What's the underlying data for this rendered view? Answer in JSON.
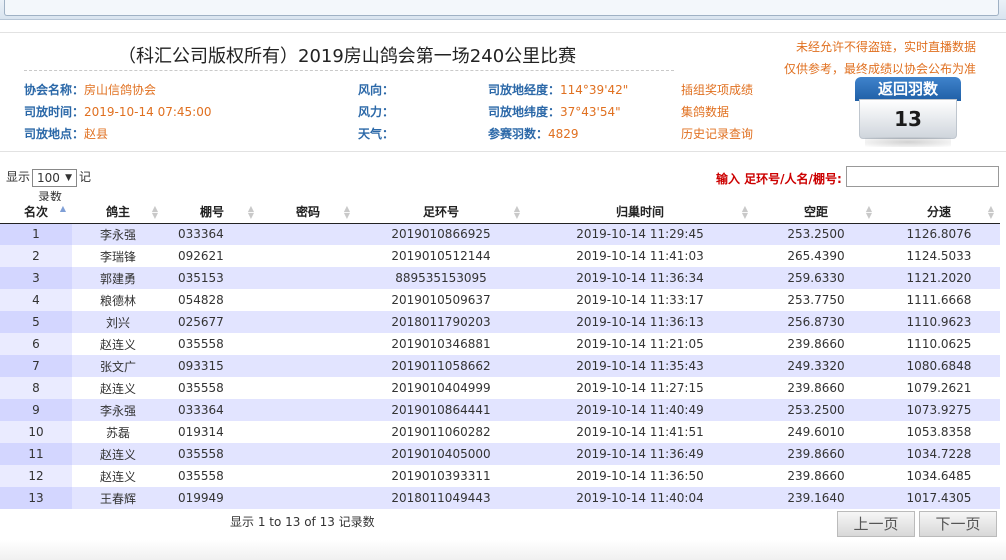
{
  "header": {
    "title": "（科汇公司版权所有）2019房山鸽会第一场240公里比赛",
    "notice_1": "未经允许不得盗链，实时直播数据",
    "notice_2": "仅供参考，最终成绩以协会公布为准"
  },
  "info": {
    "col1": [
      {
        "label": "协会名称：",
        "value": "房山信鸽协会"
      },
      {
        "label": "司放时间：",
        "value": "2019-10-14 07:45:00"
      },
      {
        "label": "司放地点：",
        "value": "赵县"
      }
    ],
    "col2": [
      {
        "label": "风向：",
        "value": ""
      },
      {
        "label": "风力：",
        "value": ""
      },
      {
        "label": "天气：",
        "value": ""
      }
    ],
    "col3": [
      {
        "label": "司放地经度：",
        "value": "114°39'42\""
      },
      {
        "label": "司放地纬度：",
        "value": "37°43'54\""
      },
      {
        "label": "参赛羽数：",
        "value": "4829"
      }
    ],
    "links": [
      "插组奖项成绩",
      "集鸽数据",
      "历史记录查询"
    ]
  },
  "return_badge": {
    "label": "返回羽数",
    "count": "13"
  },
  "controls": {
    "show_prefix": "显示",
    "page_size": "100",
    "show_suffix": "记",
    "records_label": "录数",
    "search_label": "输入 足环号/人名/棚号:",
    "search_value": ""
  },
  "table": {
    "columns": [
      "名次",
      "鸽主",
      "棚号",
      "密码",
      "足环号",
      "归巢时间",
      "空距",
      "分速"
    ],
    "rows": [
      [
        "1",
        "李永强",
        "033364",
        "",
        "2019010866925",
        "2019-10-14 11:29:45",
        "253.2500",
        "1126.8076"
      ],
      [
        "2",
        "李瑞锋",
        "092621",
        "",
        "2019010512144",
        "2019-10-14 11:41:03",
        "265.4390",
        "1124.5033"
      ],
      [
        "3",
        "郭建勇",
        "035153",
        "",
        "889535153095",
        "2019-10-14 11:36:34",
        "259.6330",
        "1121.2020"
      ],
      [
        "4",
        "粮德林",
        "054828",
        "",
        "2019010509637",
        "2019-10-14 11:33:17",
        "253.7750",
        "1111.6668"
      ],
      [
        "5",
        "刘兴",
        "025677",
        "",
        "2018011790203",
        "2019-10-14 11:36:13",
        "256.8730",
        "1110.9623"
      ],
      [
        "6",
        "赵连义",
        "035558",
        "",
        "2019010346881",
        "2019-10-14 11:21:05",
        "239.8660",
        "1110.0625"
      ],
      [
        "7",
        "张文广",
        "093315",
        "",
        "2019011058662",
        "2019-10-14 11:35:43",
        "249.3320",
        "1080.6848"
      ],
      [
        "8",
        "赵连义",
        "035558",
        "",
        "2019010404999",
        "2019-10-14 11:27:15",
        "239.8660",
        "1079.2621"
      ],
      [
        "9",
        "李永强",
        "033364",
        "",
        "2019010864441",
        "2019-10-14 11:40:49",
        "253.2500",
        "1073.9275"
      ],
      [
        "10",
        "苏磊",
        "019314",
        "",
        "2019011060282",
        "2019-10-14 11:41:51",
        "249.6010",
        "1053.8358"
      ],
      [
        "11",
        "赵连义",
        "035558",
        "",
        "2019010405000",
        "2019-10-14 11:36:49",
        "239.8660",
        "1034.7228"
      ],
      [
        "12",
        "赵连义",
        "035558",
        "",
        "2019010393311",
        "2019-10-14 11:36:50",
        "239.8660",
        "1034.6485"
      ],
      [
        "13",
        "王春辉",
        "019949",
        "",
        "2018011049443",
        "2019-10-14 11:40:04",
        "239.1640",
        "1017.4305"
      ]
    ]
  },
  "footer": {
    "info": "显示 1 to 13 of 13 记录数",
    "prev": "上一页",
    "next": "下一页"
  }
}
